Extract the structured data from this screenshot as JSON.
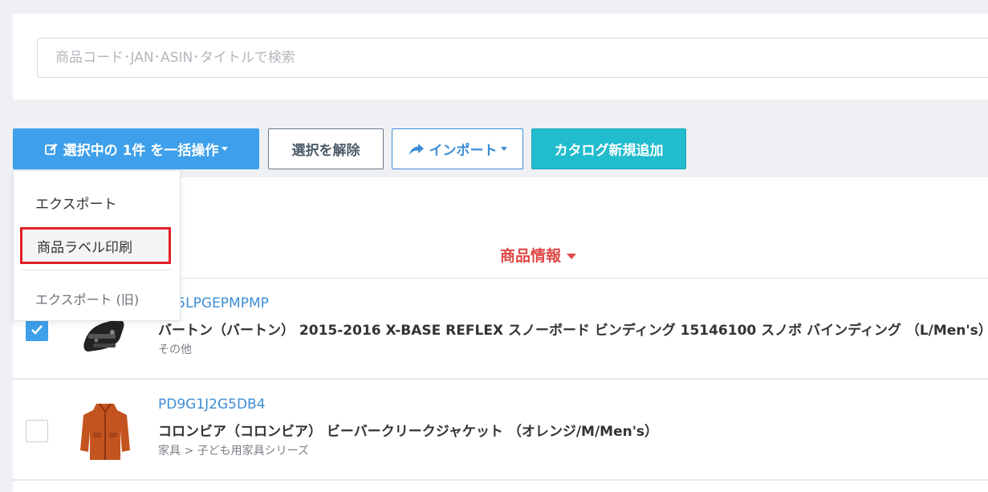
{
  "search": {
    "placeholder": "商品コード･JAN･ASIN･タイトルで検索"
  },
  "toolbar": {
    "bulk_label": "選択中の 1件 を一括操作",
    "clear_label": "選択を解除",
    "import_label": "インポート",
    "catalog_label": "カタログ新規追加"
  },
  "dropdown": {
    "items": [
      "エクスポート",
      "商品ラベル印刷",
      "エクスポート (旧)"
    ],
    "highlighted": "商品ラベル印刷"
  },
  "table": {
    "column_product": "商品情報",
    "rows": [
      {
        "checked": true,
        "code": "PD5LPGEPMPMP",
        "title": "バートン（バートン） 2015-2016 X-BASE REFLEX スノーボード ビンディング 15146100 スノボ バインディング （L/Men's）",
        "category": "その他",
        "image": "snowboard-binding"
      },
      {
        "checked": false,
        "code": "PD9G1J2G5DB4",
        "title": "コロンビア（コロンビア） ビーバークリークジャケット （オレンジ/M/Men's）",
        "category": "家具 > 子ども用家具シリーズ",
        "image": "orange-jacket"
      }
    ]
  },
  "colors": {
    "primary": "#3ea0ea",
    "catalog": "#21bccd",
    "sort_active": "#e04848",
    "highlight_border": "#e21f26"
  }
}
